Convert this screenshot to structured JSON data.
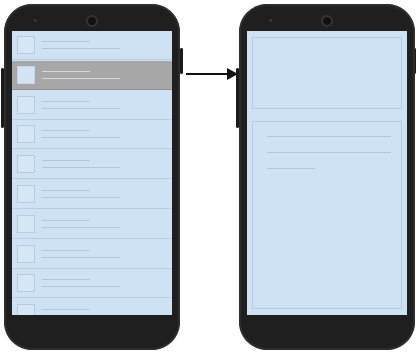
{
  "diagram": {
    "type": "master-detail navigation",
    "left_screen": {
      "list_item_count": 10,
      "selected_index": 1
    },
    "right_screen": {
      "text_line_count": 3
    },
    "connector": {
      "direction": "left-to-right",
      "icon": "arrow-right-icon"
    },
    "colors": {
      "screen": "#cfe2f3",
      "selected_row": "#a7a7a7",
      "phone_body": "#1f1f1f",
      "arrow": "#111111"
    }
  }
}
